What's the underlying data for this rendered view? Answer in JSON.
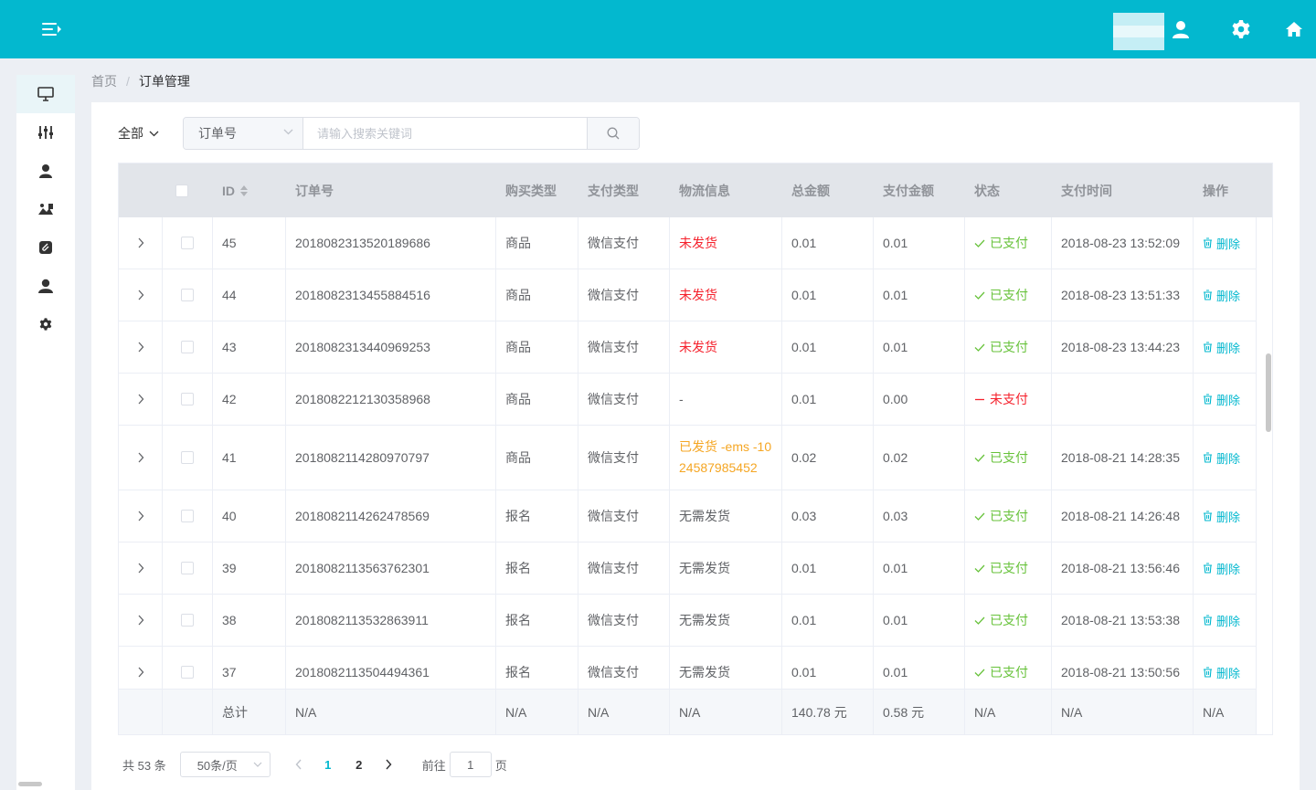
{
  "header": {
    "menu_icon": "hamburger-fold-icon",
    "user_icon": "user-icon",
    "settings_icon": "gear-icon",
    "home_icon": "home-icon",
    "accent_color": "#03b8cf"
  },
  "sidebar": {
    "items": [
      {
        "icon": "monitor-icon",
        "active": true
      },
      {
        "icon": "sliders-icon",
        "active": false
      },
      {
        "icon": "user-icon",
        "active": false
      },
      {
        "icon": "image-icon",
        "active": false
      },
      {
        "icon": "paperclip-icon",
        "active": false
      },
      {
        "icon": "user-circle-icon",
        "active": false
      },
      {
        "icon": "gear-icon",
        "active": false
      }
    ]
  },
  "breadcrumb": {
    "home": "首页",
    "separator": "/",
    "current": "订单管理"
  },
  "filter": {
    "scope_label": "全部",
    "field_select": "订单号",
    "search_placeholder": "请输入搜索关键词"
  },
  "table": {
    "columns": [
      "ID",
      "订单号",
      "购买类型",
      "支付类型",
      "物流信息",
      "总金额",
      "支付金额",
      "状态",
      "支付时间",
      "操作"
    ],
    "delete_label": "删除",
    "rows": [
      {
        "id": "45",
        "order_no": "2018082313520189686",
        "buy_type": "商品",
        "pay_type": "微信支付",
        "logistics": "未发货",
        "logistics_style": "red",
        "total": "0.01",
        "paid": "0.01",
        "status": "已支付",
        "status_style": "green",
        "pay_time": "2018-08-23 13:52:09"
      },
      {
        "id": "44",
        "order_no": "2018082313455884516",
        "buy_type": "商品",
        "pay_type": "微信支付",
        "logistics": "未发货",
        "logistics_style": "red",
        "total": "0.01",
        "paid": "0.01",
        "status": "已支付",
        "status_style": "green",
        "pay_time": "2018-08-23 13:51:33"
      },
      {
        "id": "43",
        "order_no": "2018082313440969253",
        "buy_type": "商品",
        "pay_type": "微信支付",
        "logistics": "未发货",
        "logistics_style": "red",
        "total": "0.01",
        "paid": "0.01",
        "status": "已支付",
        "status_style": "green",
        "pay_time": "2018-08-23 13:44:23"
      },
      {
        "id": "42",
        "order_no": "2018082212130358968",
        "buy_type": "商品",
        "pay_type": "微信支付",
        "logistics": "-",
        "logistics_style": "normal",
        "total": "0.01",
        "paid": "0.00",
        "status": "未支付",
        "status_style": "red",
        "pay_time": ""
      },
      {
        "id": "41",
        "order_no": "2018082114280970797",
        "buy_type": "商品",
        "pay_type": "微信支付",
        "logistics": "已发货 -ems -1024587985452",
        "logistics_style": "orange",
        "total": "0.02",
        "paid": "0.02",
        "status": "已支付",
        "status_style": "green",
        "pay_time": "2018-08-21 14:28:35"
      },
      {
        "id": "40",
        "order_no": "2018082114262478569",
        "buy_type": "报名",
        "pay_type": "微信支付",
        "logistics": "无需发货",
        "logistics_style": "normal",
        "total": "0.03",
        "paid": "0.03",
        "status": "已支付",
        "status_style": "green",
        "pay_time": "2018-08-21 14:26:48"
      },
      {
        "id": "39",
        "order_no": "2018082113563762301",
        "buy_type": "报名",
        "pay_type": "微信支付",
        "logistics": "无需发货",
        "logistics_style": "normal",
        "total": "0.01",
        "paid": "0.01",
        "status": "已支付",
        "status_style": "green",
        "pay_time": "2018-08-21 13:56:46"
      },
      {
        "id": "38",
        "order_no": "2018082113532863911",
        "buy_type": "报名",
        "pay_type": "微信支付",
        "logistics": "无需发货",
        "logistics_style": "normal",
        "total": "0.01",
        "paid": "0.01",
        "status": "已支付",
        "status_style": "green",
        "pay_time": "2018-08-21 13:53:38"
      },
      {
        "id": "37",
        "order_no": "2018082113504494361",
        "buy_type": "报名",
        "pay_type": "微信支付",
        "logistics": "无需发货",
        "logistics_style": "normal",
        "total": "0.01",
        "paid": "0.01",
        "status": "已支付",
        "status_style": "green",
        "pay_time": "2018-08-21 13:50:56"
      }
    ],
    "summary": {
      "label": "总计",
      "order_no": "N/A",
      "buy_type": "N/A",
      "pay_type": "N/A",
      "logistics": "N/A",
      "total": "140.78 元",
      "paid": "0.58 元",
      "status": "N/A",
      "pay_time": "N/A",
      "action": "N/A"
    }
  },
  "pagination": {
    "total_text": "共 53 条",
    "page_size": "50条/页",
    "pages": [
      "1",
      "2"
    ],
    "current_page": "1",
    "goto_label": "前往",
    "goto_value": "1",
    "page_suffix": "页"
  }
}
